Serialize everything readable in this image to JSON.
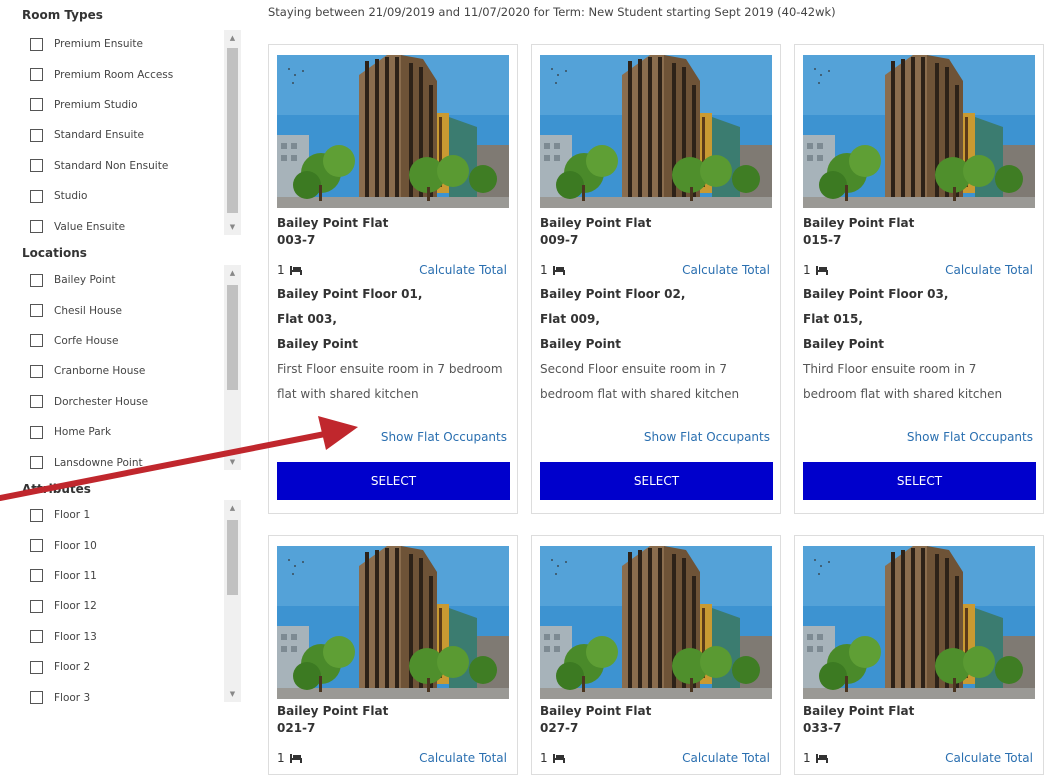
{
  "sidebar": {
    "room_types": {
      "title": "Room Types",
      "items": [
        "Premium Ensuite",
        "Premium Room Access",
        "Premium Studio",
        "Standard Ensuite",
        "Standard Non Ensuite",
        "Studio",
        "Value Ensuite"
      ]
    },
    "locations": {
      "title": "Locations",
      "items": [
        "Bailey Point",
        "Chesil House",
        "Corfe House",
        "Cranborne House",
        "Dorchester House",
        "Home Park",
        "Lansdowne Point"
      ]
    },
    "attributes": {
      "title": "Attributes",
      "items": [
        "Floor 1",
        "Floor 10",
        "Floor 11",
        "Floor 12",
        "Floor 13",
        "Floor 2",
        "Floor 3"
      ]
    }
  },
  "main": {
    "staying_text": "Staying between 21/09/2019 and 11/07/2020 for Term: New Student starting Sept 2019 (40-42wk)",
    "calculate_label": "Calculate Total",
    "occupants_label": "Show Flat Occupants",
    "select_label": "SELECT",
    "bed_count": "1",
    "cards": [
      {
        "title": "Bailey Point Flat",
        "code": "003-7",
        "addr1": "Bailey Point Floor 01,",
        "addr2": "Flat 003,",
        "addr3": "Bailey Point",
        "desc1": "First Floor ensuite room in 7 bedroom",
        "desc2": "flat with shared kitchen"
      },
      {
        "title": "Bailey Point Flat",
        "code": "009-7",
        "addr1": "Bailey Point Floor 02,",
        "addr2": "Flat 009,",
        "addr3": "Bailey Point",
        "desc1": "Second Floor ensuite room in 7",
        "desc2": "bedroom flat with shared kitchen"
      },
      {
        "title": "Bailey Point Flat",
        "code": "015-7",
        "addr1": "Bailey Point Floor 03,",
        "addr2": "Flat 015,",
        "addr3": "Bailey Point",
        "desc1": "Third Floor ensuite room in 7",
        "desc2": "bedroom flat with shared kitchen"
      },
      {
        "title": "Bailey Point Flat",
        "code": "021-7"
      },
      {
        "title": "Bailey Point Flat",
        "code": "027-7"
      },
      {
        "title": "Bailey Point Flat",
        "code": "033-7"
      }
    ]
  },
  "colors": {
    "select_button": "#0000cc",
    "link": "#2a6fb0",
    "annotation_arrow": "#c0272d"
  }
}
